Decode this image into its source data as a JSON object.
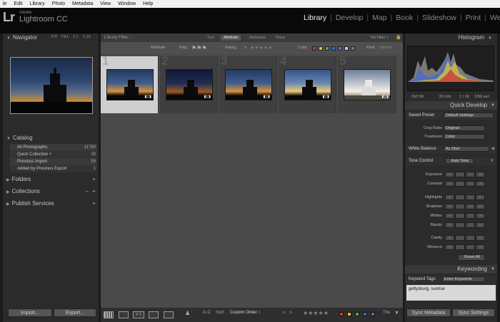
{
  "menubar": {
    "items": [
      "le",
      "Edit",
      "Library",
      "Photo",
      "Metadata",
      "View",
      "Window",
      "Help"
    ]
  },
  "identity": {
    "logo": "Lr",
    "brand_small": "Adobe",
    "brand_big": "Lightroom CC"
  },
  "modules": {
    "items": [
      "Library",
      "Develop",
      "Map",
      "Book",
      "Slideshow",
      "Print",
      "Web"
    ],
    "active": "Library"
  },
  "left": {
    "navigator": {
      "title": "Navigator",
      "zoom": [
        "FIT",
        "FILL",
        "1:1",
        "1:16"
      ]
    },
    "catalog": {
      "title": "Catalog",
      "rows": [
        {
          "label": "All Photographs",
          "count": "11760"
        },
        {
          "label": "Quick Collection +",
          "count": "28"
        },
        {
          "label": "Previous Import",
          "count": "59"
        },
        {
          "label": "Added by Previous Export",
          "count": "1"
        }
      ]
    },
    "folders": {
      "title": "Folders"
    },
    "collections": {
      "title": "Collections"
    },
    "publish": {
      "title": "Publish Services"
    },
    "import_label": "Import...",
    "export_label": "Export..."
  },
  "filter": {
    "label": "Library Filter :",
    "tabs": [
      "Text",
      "Attribute",
      "Metadata",
      "None"
    ],
    "active_tab": "Attribute",
    "no_filter": "No Filter ↕",
    "attr": {
      "attribute": "Attribute",
      "flag": "Flag",
      "rating": "Rating",
      "rating_op": "≥",
      "color": "Color",
      "kind": "Kind"
    },
    "swatch_colors": [
      "#c83a3a",
      "#d4c43a",
      "#4aa84a",
      "#3a6ac8",
      "#9a4ac8",
      "#cccccc",
      "#777777"
    ]
  },
  "grid": {
    "cells": [
      {
        "index": "1",
        "selected": true,
        "tone": "sunset"
      },
      {
        "index": "2",
        "selected": false,
        "tone": "dusk"
      },
      {
        "index": "3",
        "selected": false,
        "tone": "sunset"
      },
      {
        "index": "4",
        "selected": false,
        "tone": "bright"
      },
      {
        "index": "5",
        "selected": false,
        "tone": "day"
      }
    ]
  },
  "bottom": {
    "sort_label": "Sort:",
    "sort_value": "Custom Order ↕",
    "thumbnails": "Thu",
    "color_labels": [
      "#c83a3a",
      "#d4c43a",
      "#4aa84a",
      "#3a6ac8",
      "#9a4ac8"
    ]
  },
  "right": {
    "histogram": {
      "title": "Histogram",
      "iso": "ISO 50",
      "focal": "33 mm",
      "aperture": "ƒ / 16",
      "shutter": "1/50 sec"
    },
    "quick_develop": {
      "title": "Quick Develop",
      "saved_preset_label": "Saved Preset",
      "saved_preset_value": "Default Settings",
      "crop_label": "Crop Ratio",
      "crop_value": "Original",
      "treatment_label": "Treatment",
      "treatment_value": "Color",
      "wb_label": "White Balance",
      "wb_value": "As Shot",
      "tone_label": "Tone Control",
      "auto_tone": "Auto Tone",
      "sliders": [
        "Exposure",
        "Contrast",
        "Highlights",
        "Shadows",
        "Whites",
        "Blacks",
        "Clarity",
        "Vibrance"
      ],
      "reset": "Reset All"
    },
    "keywording": {
      "title": "Keywording",
      "tags_label": "Keyword Tags",
      "tags_value": "Enter Keywords",
      "keywords": "gettysburg, sunrise"
    },
    "sync_metadata": "Sync Metadata",
    "sync_settings": "Sync Settings"
  }
}
